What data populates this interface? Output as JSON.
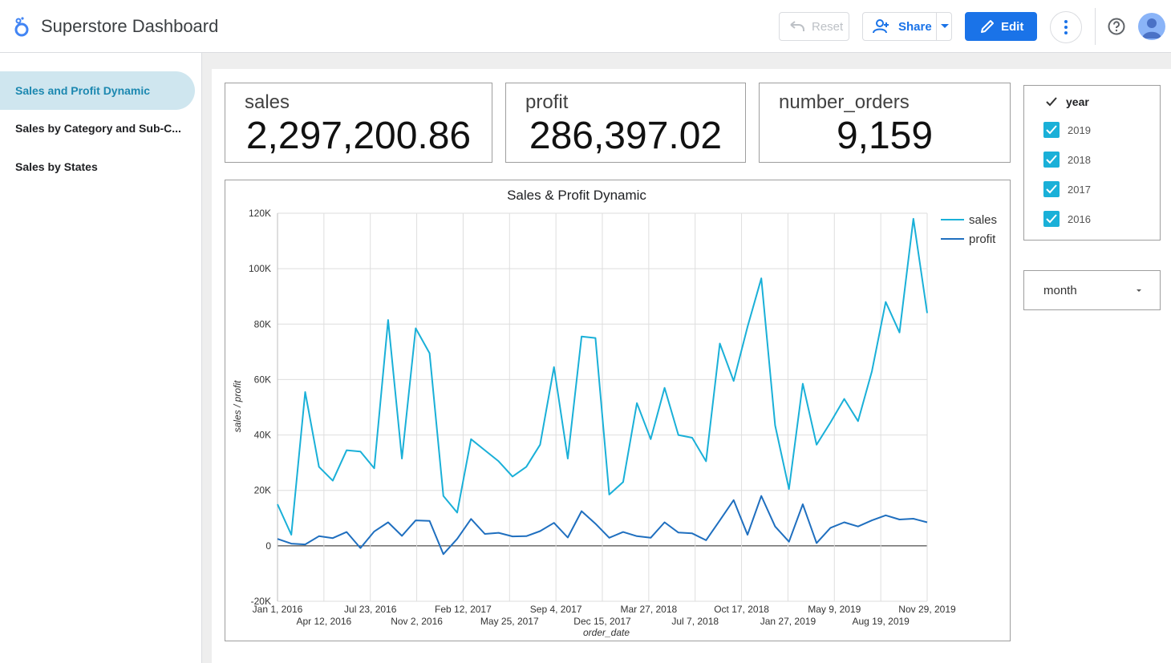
{
  "header": {
    "title": "Superstore Dashboard",
    "reset_label": "Reset",
    "share_label": "Share",
    "edit_label": "Edit"
  },
  "sidebar": {
    "items": [
      {
        "label": "Sales and Profit Dynamic",
        "active": true
      },
      {
        "label": "Sales by Category and Sub-C..."
      },
      {
        "label": "Sales by States"
      }
    ]
  },
  "scorecards": [
    {
      "label": "sales",
      "value": "2,297,200.86"
    },
    {
      "label": "profit",
      "value": "286,397.02"
    },
    {
      "label": "number_orders",
      "value": "9,159"
    }
  ],
  "filter": {
    "header": "year",
    "options": [
      "2019",
      "2018",
      "2017",
      "2016"
    ],
    "checked_color": "#1ab0d8"
  },
  "dropdown": {
    "value": "month"
  },
  "colors": {
    "sales": "#1ab0d8",
    "profit": "#1f6fbf",
    "accent": "#1a73e8"
  },
  "chart_data": {
    "type": "line",
    "title": "Sales & Profit Dynamic",
    "xlabel": "order_date",
    "ylabel": "sales / profit",
    "ylim": [
      -20000,
      120000
    ],
    "yticks": [
      -20000,
      0,
      20000,
      40000,
      60000,
      80000,
      100000,
      120000
    ],
    "ytick_labels": [
      "-20K",
      "0",
      "20K",
      "40K",
      "60K",
      "80K",
      "100K",
      "120K"
    ],
    "xtick_labels": [
      "Jan 1, 2016",
      "Apr 12, 2016",
      "Jul 23, 2016",
      "Nov 2, 2016",
      "Feb 12, 2017",
      "May 25, 2017",
      "Sep 4, 2017",
      "Dec 15, 2017",
      "Mar 27, 2018",
      "Jul 7, 2018",
      "Oct 17, 2018",
      "Jan 27, 2019",
      "May 9, 2019",
      "Aug 19, 2019",
      "Nov 29, 2019"
    ],
    "legend": "top-right",
    "grid": true,
    "series": [
      {
        "name": "sales",
        "values": [
          15000,
          4000,
          55500,
          28500,
          23500,
          34500,
          34000,
          28000,
          81500,
          31500,
          78500,
          69500,
          18000,
          12000,
          38500,
          34500,
          30500,
          25000,
          28500,
          36500,
          64500,
          31500,
          75500,
          75000,
          18500,
          23000,
          51500,
          38500,
          57000,
          40000,
          39000,
          30500,
          73000,
          59500,
          79000,
          96500,
          43500,
          20500,
          58500,
          36500,
          44500,
          53000,
          45000,
          63000,
          88000,
          77000,
          118000,
          84000
        ]
      },
      {
        "name": "profit",
        "values": [
          2500,
          800,
          500,
          3500,
          2800,
          5000,
          -800,
          5200,
          8500,
          3600,
          9200,
          9000,
          -3000,
          2500,
          9700,
          4300,
          4700,
          3400,
          3500,
          5300,
          8300,
          3000,
          12500,
          8000,
          2900,
          5000,
          3500,
          2900,
          8500,
          4800,
          4500,
          2000,
          9200,
          16500,
          4000,
          18000,
          7000,
          1500,
          15000,
          1000,
          6500,
          8500,
          7000,
          9200,
          11000,
          9500,
          9800,
          8500
        ]
      }
    ]
  }
}
